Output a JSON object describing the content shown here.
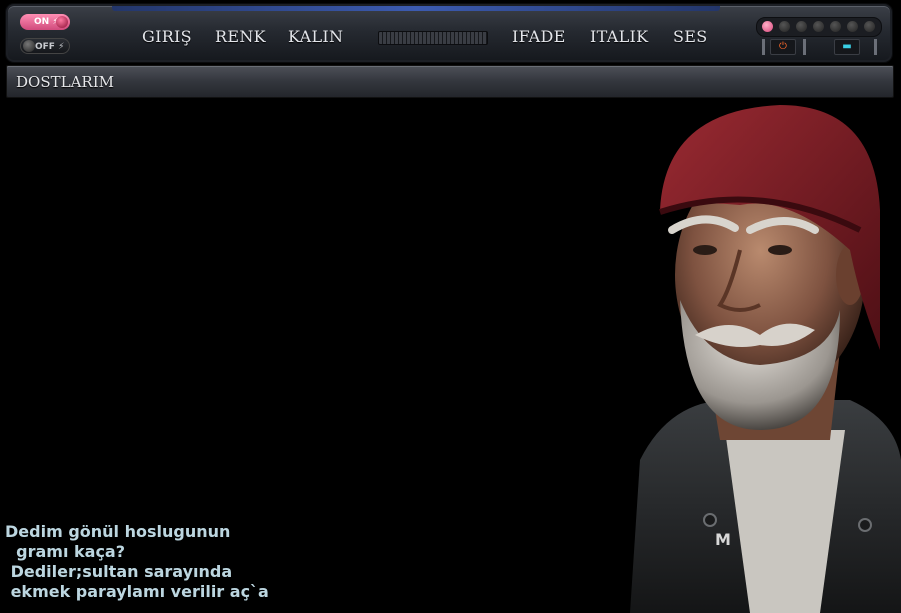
{
  "toolbar": {
    "power_on_label": "ON ⚡",
    "power_off_label": "OFF ⚡",
    "menu": [
      {
        "label": "GIRIŞ"
      },
      {
        "label": "RENK"
      },
      {
        "label": "KALIN"
      },
      {
        "label": "IFADE"
      },
      {
        "label": "ITALIK"
      },
      {
        "label": "SES"
      }
    ],
    "power_button_glyph": "⏻",
    "screen_button_glyph": "▬",
    "led_active_index": 0
  },
  "titlebar": {
    "title": "DOSTLARIM"
  },
  "portrait": {
    "watermark": "M"
  },
  "poem": {
    "lines": [
      "Dedim gönül hoslugunun",
      "  gramı kaça?",
      " Dediler;sultan sarayında",
      " ekmek paraylamı verilir aç`a"
    ]
  },
  "colors": {
    "background": "#000000",
    "poem_text": "#bcd6e0",
    "accent_pink": "#d8457a",
    "accent_blue": "#3c5bb0"
  }
}
